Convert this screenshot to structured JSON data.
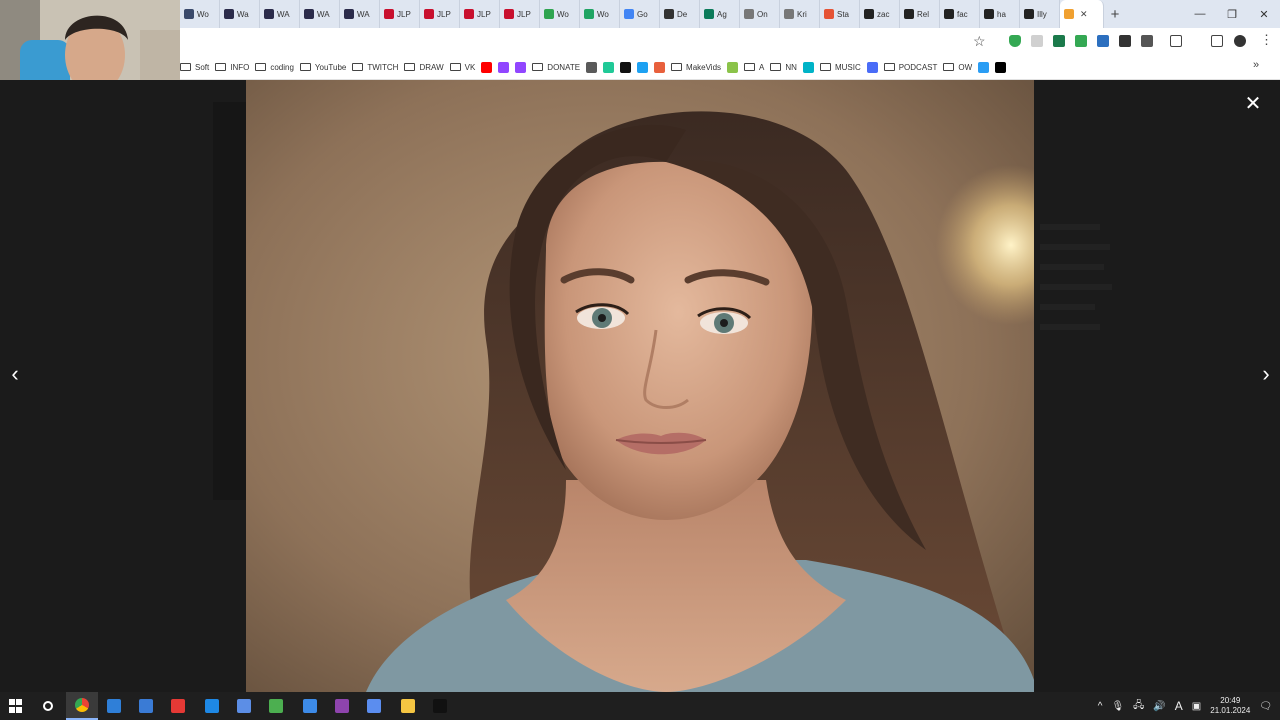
{
  "tabs": [
    {
      "label": "Wo",
      "color": "#3b4a6b"
    },
    {
      "label": "Wa",
      "color": "#2b2b4a"
    },
    {
      "label": "WA",
      "color": "#2b2b4a"
    },
    {
      "label": "WA",
      "color": "#2b2b4a"
    },
    {
      "label": "WA",
      "color": "#2b2b4a"
    },
    {
      "label": "JLP",
      "color": "#c8102e"
    },
    {
      "label": "JLP",
      "color": "#c8102e"
    },
    {
      "label": "JLP",
      "color": "#c8102e"
    },
    {
      "label": "JLP",
      "color": "#c8102e"
    },
    {
      "label": "Wo",
      "color": "#2ea44f"
    },
    {
      "label": "Wo",
      "color": "#1fa463"
    },
    {
      "label": "Go",
      "color": "#4285f4"
    },
    {
      "label": "De",
      "color": "#333333"
    },
    {
      "label": "Ag",
      "color": "#0b7a5a"
    },
    {
      "label": "On",
      "color": "#777777"
    },
    {
      "label": "Kri",
      "color": "#777777"
    },
    {
      "label": "Sta",
      "color": "#e55335"
    },
    {
      "label": "zac",
      "color": "#222222"
    },
    {
      "label": "Rel",
      "color": "#222222"
    },
    {
      "label": "fac",
      "color": "#222222"
    },
    {
      "label": "ha",
      "color": "#222222"
    },
    {
      "label": "Illy",
      "color": "#222222"
    },
    {
      "label": "",
      "color": "#f0a030",
      "active": true
    }
  ],
  "new_tab_label": "+",
  "window_controls": [
    "—",
    "❐",
    "✕"
  ],
  "bookmarks": [
    {
      "type": "folder",
      "label": "Soft"
    },
    {
      "type": "folder",
      "label": "INFO"
    },
    {
      "type": "folder",
      "label": "coding"
    },
    {
      "type": "folder",
      "label": "YouTube"
    },
    {
      "type": "folder",
      "label": "TWITCH"
    },
    {
      "type": "folder",
      "label": "DRAW"
    },
    {
      "type": "folder",
      "label": "VK"
    },
    {
      "type": "icon",
      "label": "",
      "color": "#ff0000"
    },
    {
      "type": "icon",
      "label": "",
      "color": "#9146ff"
    },
    {
      "type": "icon",
      "label": "",
      "color": "#9146ff"
    },
    {
      "type": "folder",
      "label": "DONATE"
    },
    {
      "type": "icon",
      "label": "",
      "color": "#5a5a5a"
    },
    {
      "type": "icon",
      "label": "",
      "color": "#20c997"
    },
    {
      "type": "icon",
      "label": "",
      "color": "#111111"
    },
    {
      "type": "icon",
      "label": "",
      "color": "#1da1f2"
    },
    {
      "type": "icon",
      "label": "",
      "color": "#e8603c"
    },
    {
      "type": "folder",
      "label": "MakeVids"
    },
    {
      "type": "icon",
      "label": "",
      "color": "#8bc34a"
    },
    {
      "type": "folder",
      "label": "A"
    },
    {
      "type": "folder",
      "label": "NN"
    },
    {
      "type": "icon",
      "label": "",
      "color": "#00b3c7"
    },
    {
      "type": "folder",
      "label": "MUSIC"
    },
    {
      "type": "icon",
      "label": "",
      "color": "#4a6cf7"
    },
    {
      "type": "folder",
      "label": "PODCAST"
    },
    {
      "type": "folder",
      "label": "OW"
    },
    {
      "type": "icon",
      "label": "",
      "color": "#2a9df4"
    },
    {
      "type": "icon",
      "label": "",
      "color": "#000000"
    }
  ],
  "viewer": {
    "close_label": "✕",
    "prev_label": "‹",
    "next_label": "›"
  },
  "taskbar": {
    "icons": [
      {
        "name": "windows-start",
        "color": "#ffffff"
      },
      {
        "name": "search",
        "color": "#ffffff"
      },
      {
        "name": "chrome",
        "color": "#e94235",
        "active": true
      },
      {
        "name": "app-blue",
        "color": "#2f7fd8"
      },
      {
        "name": "calculator",
        "color": "#3a7bd5"
      },
      {
        "name": "screen-recorder",
        "color": "#e53935"
      },
      {
        "name": "app-edge",
        "color": "#1e88e5"
      },
      {
        "name": "app-arrow",
        "color": "#5c8ee6"
      },
      {
        "name": "notepad-green",
        "color": "#4caf50"
      },
      {
        "name": "app-t",
        "color": "#3d8be8"
      },
      {
        "name": "onenote",
        "color": "#8e44ad"
      },
      {
        "name": "app-monitor",
        "color": "#5b8def"
      },
      {
        "name": "file-explorer",
        "color": "#f4c542"
      },
      {
        "name": "terminal",
        "color": "#111111"
      }
    ],
    "tray_text": "A",
    "time": "20:49",
    "date": "21.01.2024"
  },
  "colors": {
    "accent": "#8ab4f8",
    "viewer_bg": "#1b1b1b",
    "taskbar_bg": "#1f1f1f"
  }
}
